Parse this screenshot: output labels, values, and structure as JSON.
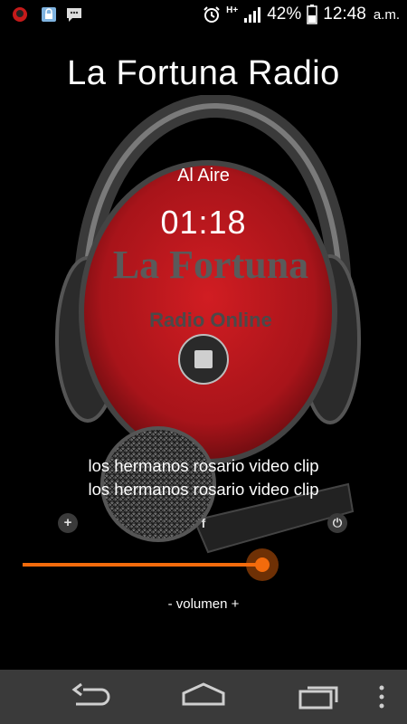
{
  "status_bar": {
    "battery_percent": "42%",
    "network": "H+",
    "time": "12:48",
    "ampm": "a.m.",
    "notification_icons": [
      "app-notification-icon",
      "lock-app-icon",
      "chat-icon"
    ],
    "system_icons": [
      "alarm-icon",
      "signal-icon",
      "battery-icon"
    ]
  },
  "app": {
    "title": "La Fortuna Radio",
    "logo_text": "La Fortuna",
    "logo_subtext": "Radio Online"
  },
  "player": {
    "status": "Al Aire",
    "timer": "01:18",
    "now_playing_line1": "los hermanos rosario video clip",
    "now_playing_line2": "los hermanos rosario video clip",
    "stop_icon": "stop-icon",
    "add_icon_glyph": "+",
    "facebook_icon_glyph": "f",
    "power_icon_glyph": "⏻",
    "volume_label": "- volumen +",
    "volume_level": 0.63
  },
  "colors": {
    "accent": "#f36b0c",
    "logo_red": "#b5121b",
    "background": "#000000"
  },
  "nav_bar": {
    "buttons": [
      "back-icon",
      "home-icon",
      "recent-apps-icon",
      "overflow-menu-icon"
    ]
  }
}
